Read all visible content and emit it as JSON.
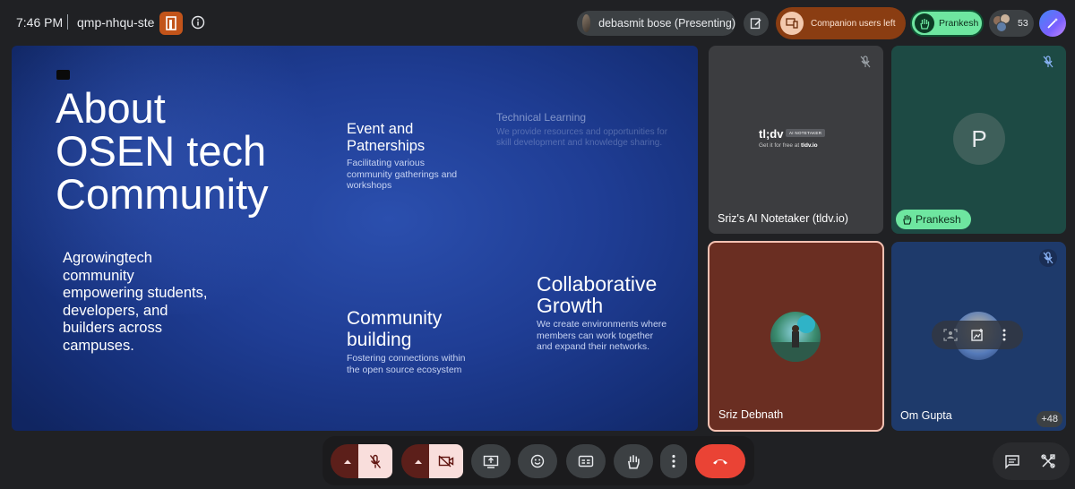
{
  "topbar": {
    "time": "7:46 PM",
    "meeting_code": "qmp-nhqu-ste",
    "presenter_label": "debasmit bose (Presenting)",
    "companion_label": "Companion users left",
    "hand_raised_label": "Prankesh",
    "participant_count": "53"
  },
  "slide": {
    "title": "About\nOSEN tech\nCommunity",
    "subtitle": "Agrowingtech\ncommunity\nempowering students,\ndevelopers, and\nbuilders across\ncampuses.",
    "sections": [
      {
        "heading": "Event and\nPatnerships",
        "body": "Facilitating various\ncommunity gatherings and\nworkshops"
      },
      {
        "heading": "Community\nbuilding",
        "body": "Fostering connections within\nthe open source ecosystem"
      },
      {
        "heading": "Collaborative\nGrowth",
        "body": "We create environments where\nmembers can work together\nand expand their networks."
      }
    ],
    "tech": {
      "heading": "Technical Learning",
      "body": "We provide resources and opportunities for\nskill development and knowledge sharing."
    }
  },
  "tiles": [
    {
      "name": "Sriz's AI Notetaker (tldv.io)",
      "logo": "tl;dv",
      "badge": "AI NOTETAKER",
      "tagline_prefix": "Get it for free at",
      "tagline_link": "tldv.io"
    },
    {
      "name": "Prankesh",
      "initial": "P"
    },
    {
      "name": "Sriz Debnath"
    },
    {
      "name": "Om Gupta",
      "more": "+48"
    }
  ],
  "colors": {
    "end_call": "#ea4335",
    "hand_raise": "#6ee6a0",
    "companion": "#8a3d12",
    "slide_blue": "#1f3d94"
  }
}
